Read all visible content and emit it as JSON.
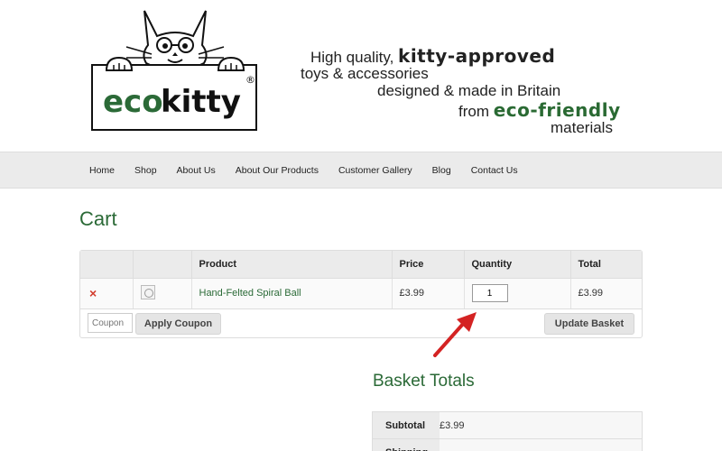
{
  "brand": {
    "name": "ecokitty",
    "registered_mark": "®"
  },
  "tagline": {
    "line1_prefix": "High quality, ",
    "line1_emphasis": "kitty-approved",
    "line2": "toys & accessories",
    "line3": "designed & made in Britain",
    "line4_prefix": "from ",
    "line4_emphasis": "eco-friendly",
    "line5": "materials"
  },
  "nav": {
    "items": [
      {
        "label": "Home"
      },
      {
        "label": "Shop"
      },
      {
        "label": "About Us"
      },
      {
        "label": "About Our Products"
      },
      {
        "label": "Customer Gallery"
      },
      {
        "label": "Blog"
      },
      {
        "label": "Contact Us"
      }
    ]
  },
  "page": {
    "title": "Cart"
  },
  "cart": {
    "columns": [
      "",
      "",
      "Product",
      "Price",
      "Quantity",
      "Total"
    ],
    "rows": [
      {
        "remove_symbol": "×",
        "product": "Hand-Felted Spiral Ball",
        "price": "£3.99",
        "quantity": "1",
        "total": "£3.99"
      }
    ],
    "coupon_placeholder": "Coupon",
    "apply_coupon_label": "Apply Coupon",
    "update_basket_label": "Update Basket"
  },
  "totals": {
    "title": "Basket Totals",
    "subtotal_label": "Subtotal",
    "subtotal_value": "£3.99",
    "shipping_label": "Shipping"
  },
  "colors": {
    "brand_green": "#2b6a37",
    "remove_red": "#d23b2c",
    "annotation_arrow": "#d42323"
  },
  "icons": {
    "remove": "close-icon",
    "thumbnail": "product-thumbnail",
    "annotation": "red-arrow-icon"
  }
}
